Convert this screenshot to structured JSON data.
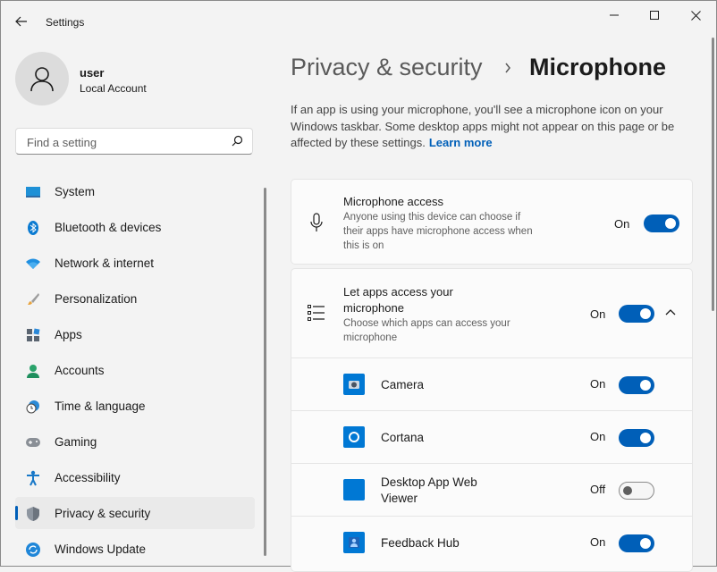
{
  "window": {
    "title": "Settings"
  },
  "profile": {
    "name": "user",
    "account": "Local Account"
  },
  "search": {
    "placeholder": "Find a setting"
  },
  "nav": [
    {
      "label": "System",
      "icon": "system-icon"
    },
    {
      "label": "Bluetooth & devices",
      "icon": "bluetooth-icon"
    },
    {
      "label": "Network & internet",
      "icon": "wifi-icon"
    },
    {
      "label": "Personalization",
      "icon": "brush-icon"
    },
    {
      "label": "Apps",
      "icon": "apps-icon"
    },
    {
      "label": "Accounts",
      "icon": "accounts-icon"
    },
    {
      "label": "Time & language",
      "icon": "clock-globe-icon"
    },
    {
      "label": "Gaming",
      "icon": "gamepad-icon"
    },
    {
      "label": "Accessibility",
      "icon": "accessibility-icon"
    },
    {
      "label": "Privacy & security",
      "icon": "shield-icon",
      "selected": true
    },
    {
      "label": "Windows Update",
      "icon": "update-icon"
    }
  ],
  "breadcrumb": {
    "parent": "Privacy & security",
    "current": "Microphone"
  },
  "description": {
    "text": "If an app is using your microphone, you'll see a microphone icon on your Windows taskbar. Some desktop apps might not appear on this page or be affected by these settings.",
    "link": "Learn more"
  },
  "mic_access": {
    "title": "Microphone access",
    "subtitle": "Anyone using this device can choose if their apps have microphone access when this is on",
    "state": "On"
  },
  "app_access": {
    "title": "Let apps access your microphone",
    "subtitle": "Choose which apps can access your microphone",
    "state": "On",
    "apps": [
      {
        "name": "Camera",
        "state": "On",
        "icon": "camera-app-icon"
      },
      {
        "name": "Cortana",
        "state": "On",
        "icon": "cortana-app-icon"
      },
      {
        "name": "Desktop App Web Viewer",
        "state": "Off",
        "icon": "web-viewer-app-icon"
      },
      {
        "name": "Feedback Hub",
        "state": "On",
        "icon": "feedback-hub-app-icon"
      }
    ]
  },
  "colors": {
    "accent": "#005fb8",
    "background": "#f3f3f3",
    "card": "#fbfbfb"
  }
}
